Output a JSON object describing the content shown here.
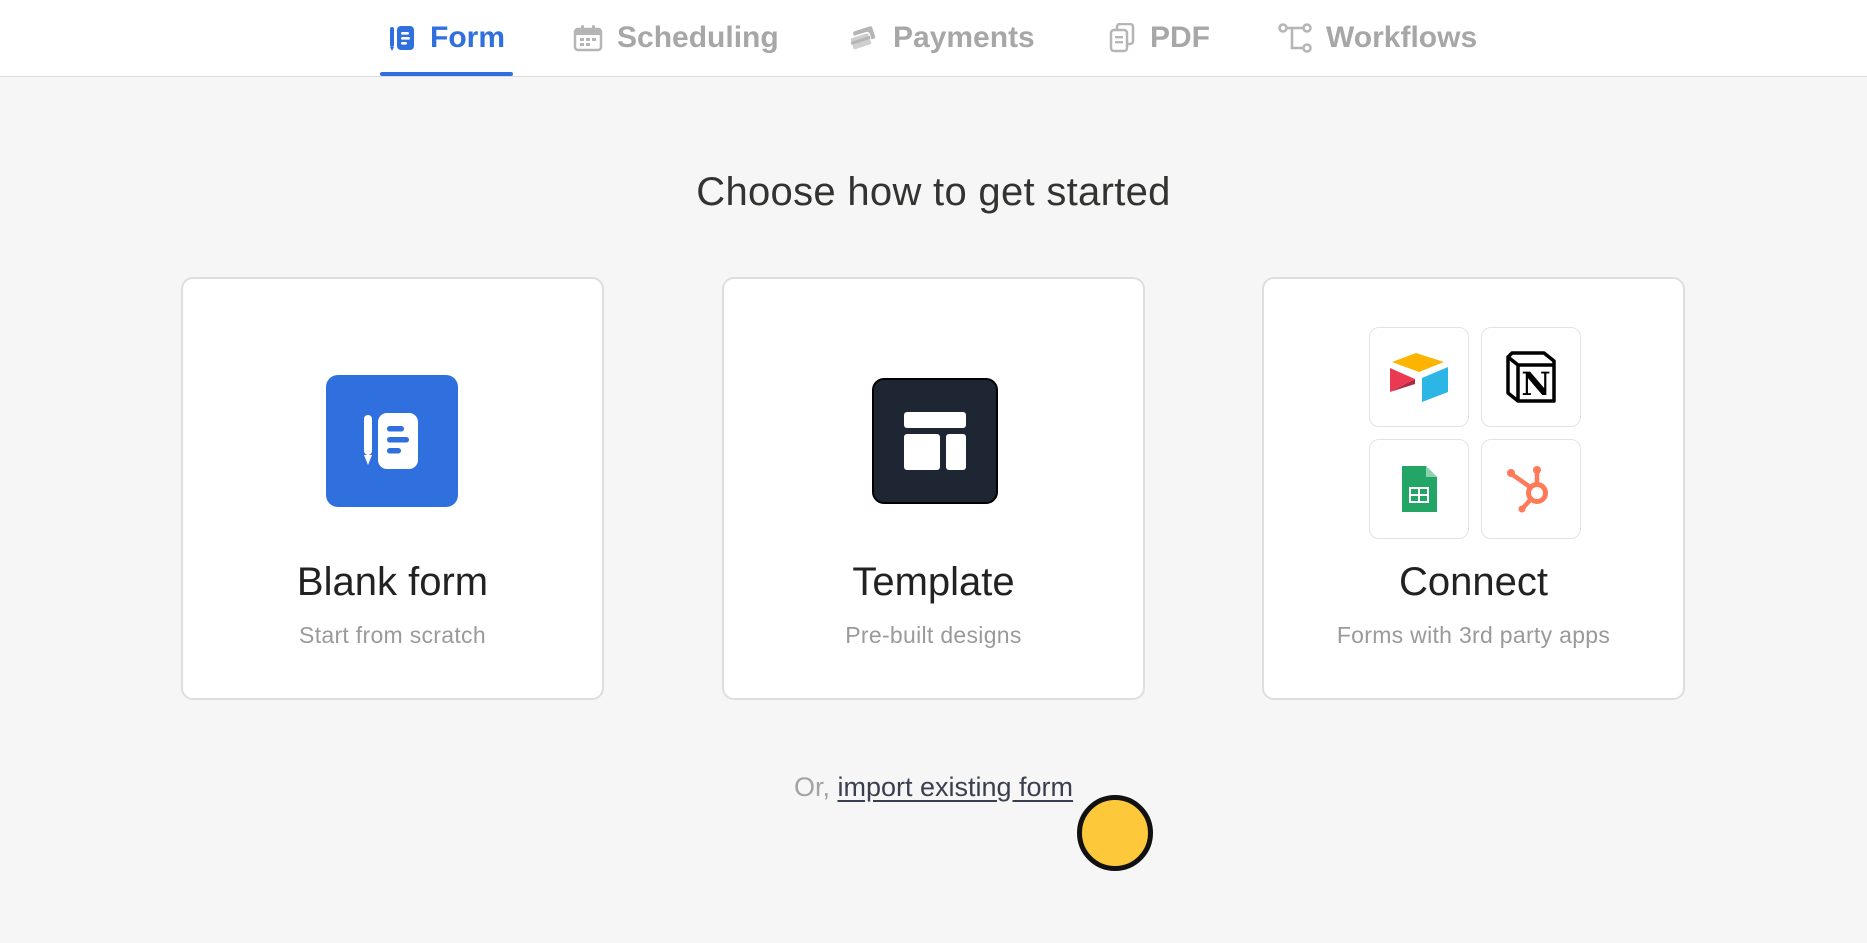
{
  "tabs": [
    {
      "label": "Form",
      "icon": "form-icon",
      "active": true
    },
    {
      "label": "Scheduling",
      "icon": "calendar-icon",
      "active": false
    },
    {
      "label": "Payments",
      "icon": "payments-icon",
      "active": false
    },
    {
      "label": "PDF",
      "icon": "pdf-icon",
      "active": false
    },
    {
      "label": "Workflows",
      "icon": "workflows-icon",
      "active": false
    }
  ],
  "heading": "Choose how to get started",
  "cards": [
    {
      "title": "Blank form",
      "subtitle": "Start from scratch",
      "icon": "blank-form-icon"
    },
    {
      "title": "Template",
      "subtitle": "Pre-built designs",
      "icon": "template-icon"
    },
    {
      "title": "Connect",
      "subtitle": "Forms with 3rd party apps",
      "icon": "connect-apps"
    }
  ],
  "connect_apps": [
    "airtable-icon",
    "notion-icon",
    "google-sheets-icon",
    "hubspot-icon"
  ],
  "import": {
    "prefix": "Or,",
    "link": "import existing form"
  },
  "colors": {
    "accent": "#2f6fde",
    "template_dark": "#1f2633",
    "background": "#f6f6f6",
    "cursor": "#fdc93a"
  }
}
